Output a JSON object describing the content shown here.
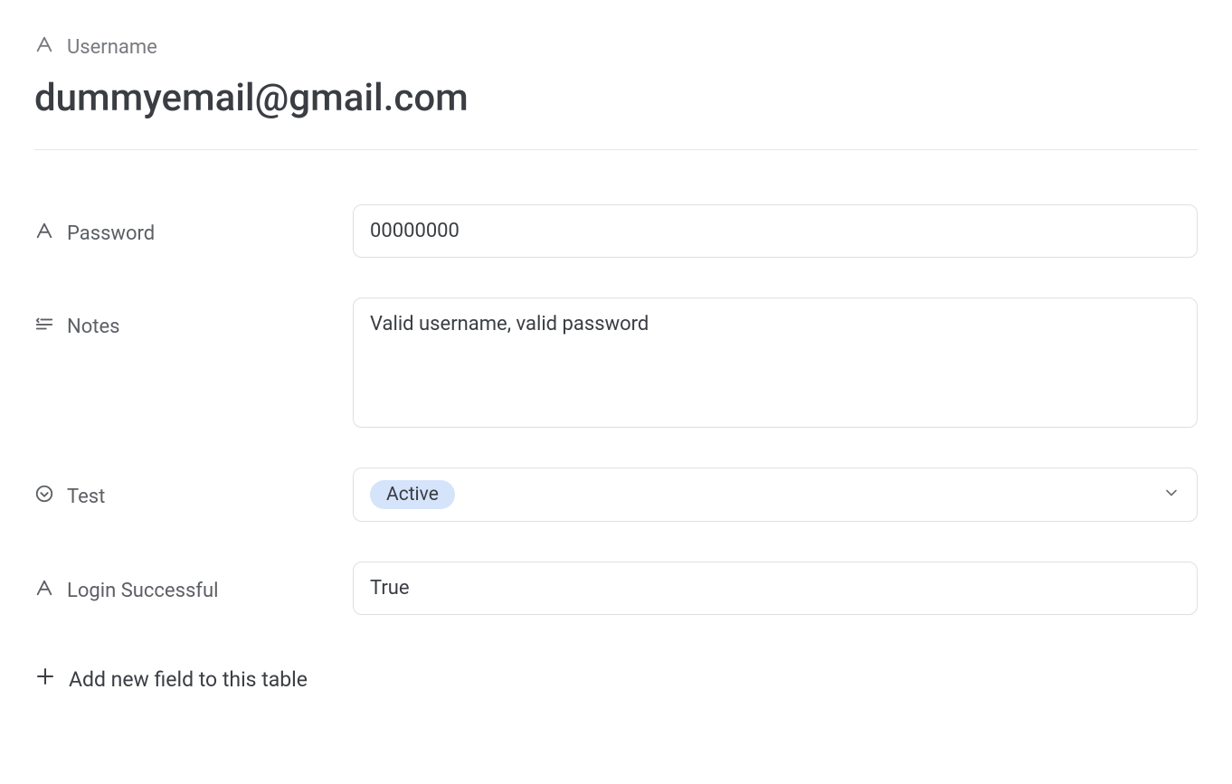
{
  "header": {
    "field_label": "Username",
    "title": "dummyemail@gmail.com"
  },
  "fields": {
    "password": {
      "label": "Password",
      "value": "00000000"
    },
    "notes": {
      "label": "Notes",
      "value": "Valid username, valid password"
    },
    "test": {
      "label": "Test",
      "selected": "Active"
    },
    "login_successful": {
      "label": "Login Successful",
      "value": "True"
    }
  },
  "actions": {
    "add_field_label": "Add new field to this table"
  }
}
